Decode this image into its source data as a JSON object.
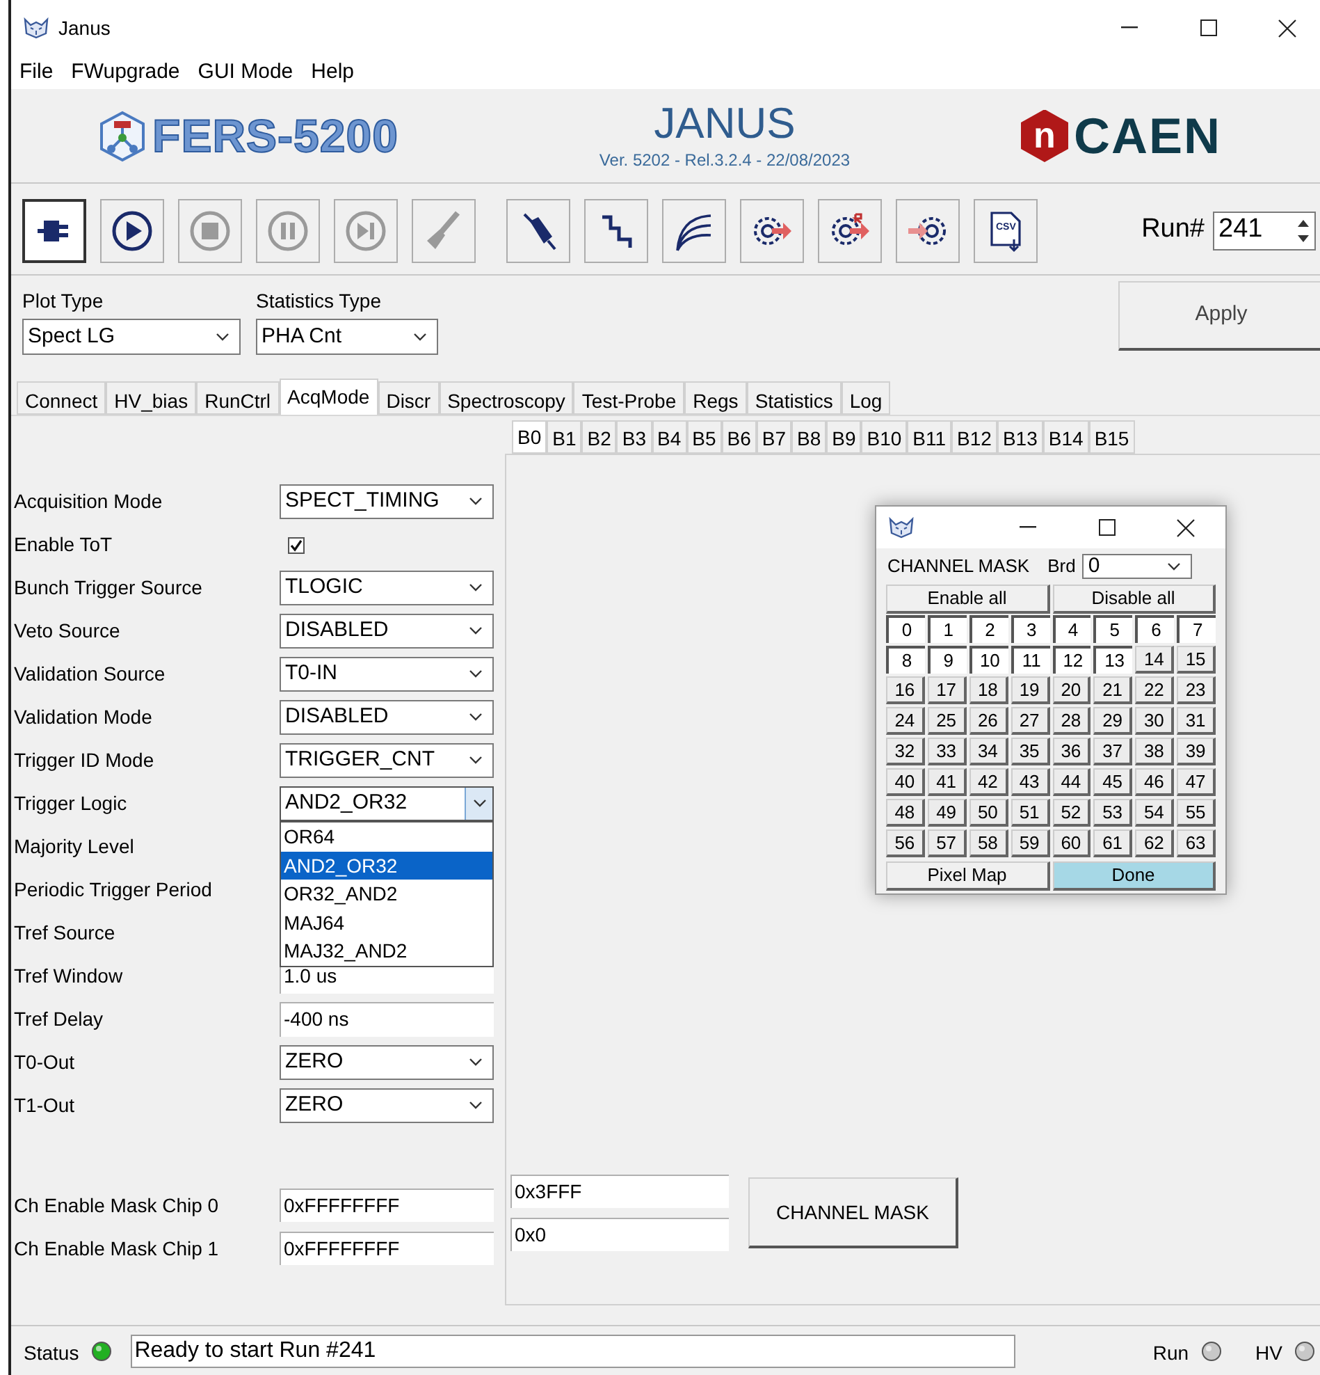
{
  "window": {
    "title": "Janus"
  },
  "menu": [
    "File",
    "FWupgrade",
    "GUI Mode",
    "Help"
  ],
  "header": {
    "product": "FERS-5200",
    "title": "JANUS",
    "version": "Ver. 5202 - Rel.3.2.4 - 22/08/2023",
    "brand_mark": "n",
    "brand": "CAEN"
  },
  "toolbar": [
    {
      "kind": "plug",
      "selected": true,
      "disabled": false
    },
    {
      "kind": "play",
      "selected": false,
      "disabled": false
    },
    {
      "kind": "stop",
      "selected": false,
      "disabled": true
    },
    {
      "kind": "pause",
      "selected": false,
      "disabled": true
    },
    {
      "kind": "step",
      "selected": false,
      "disabled": true
    },
    {
      "kind": "brush",
      "selected": false,
      "disabled": true
    },
    {
      "kind": "probe",
      "selected": false,
      "disabled": false
    },
    {
      "kind": "staircase",
      "selected": false,
      "disabled": false
    },
    {
      "kind": "curves",
      "selected": false,
      "disabled": false
    },
    {
      "kind": "gear-out",
      "selected": false,
      "disabled": false
    },
    {
      "kind": "gear-out-r",
      "selected": false,
      "disabled": false
    },
    {
      "kind": "gear-in",
      "selected": false,
      "disabled": false
    },
    {
      "kind": "csv",
      "label": "CSV",
      "selected": false,
      "disabled": false
    }
  ],
  "run": {
    "label": "Run#",
    "value": "241"
  },
  "plot_type": {
    "label": "Plot Type",
    "value": "Spect LG"
  },
  "statistics_type": {
    "label": "Statistics Type",
    "value": "PHA Cnt"
  },
  "apply_button": "Apply",
  "tabs": [
    {
      "label": "Connect",
      "selected": false
    },
    {
      "label": "HV_bias",
      "selected": false
    },
    {
      "label": "RunCtrl",
      "selected": false
    },
    {
      "label": "AcqMode",
      "selected": true
    },
    {
      "label": "Discr",
      "selected": false
    },
    {
      "label": "Spectroscopy",
      "selected": false
    },
    {
      "label": "Test-Probe",
      "selected": false
    },
    {
      "label": "Regs",
      "selected": false
    },
    {
      "label": "Statistics",
      "selected": false
    },
    {
      "label": "Log",
      "selected": false
    }
  ],
  "board_tabs": [
    {
      "label": "B0",
      "selected": true
    },
    {
      "label": "B1",
      "selected": false
    },
    {
      "label": "B2",
      "selected": false
    },
    {
      "label": "B3",
      "selected": false
    },
    {
      "label": "B4",
      "selected": false
    },
    {
      "label": "B5",
      "selected": false
    },
    {
      "label": "B6",
      "selected": false
    },
    {
      "label": "B7",
      "selected": false
    },
    {
      "label": "B8",
      "selected": false
    },
    {
      "label": "B9",
      "selected": false
    },
    {
      "label": "B10",
      "selected": false
    },
    {
      "label": "B11",
      "selected": false
    },
    {
      "label": "B12",
      "selected": false
    },
    {
      "label": "B13",
      "selected": false
    },
    {
      "label": "B14",
      "selected": false
    },
    {
      "label": "B15",
      "selected": false
    }
  ],
  "settings": [
    {
      "label": "Acquisition Mode",
      "kind": "dropdown",
      "value": "SPECT_TIMING"
    },
    {
      "label": "Enable ToT",
      "kind": "checkbox",
      "checked": true
    },
    {
      "label": "Bunch Trigger Source",
      "kind": "dropdown",
      "value": "TLOGIC"
    },
    {
      "label": "Veto Source",
      "kind": "dropdown",
      "value": "DISABLED"
    },
    {
      "label": "Validation Source",
      "kind": "dropdown",
      "value": "T0-IN"
    },
    {
      "label": "Validation Mode",
      "kind": "dropdown",
      "value": "DISABLED"
    },
    {
      "label": "Trigger ID Mode",
      "kind": "dropdown",
      "value": "TRIGGER_CNT"
    },
    {
      "label": "Trigger Logic",
      "kind": "dropdown",
      "value": "AND2_OR32",
      "expanded": true,
      "options": [
        {
          "label": "OR64",
          "selected": false
        },
        {
          "label": "AND2_OR32",
          "selected": true
        },
        {
          "label": "OR32_AND2",
          "selected": false
        },
        {
          "label": "MAJ64",
          "selected": false
        },
        {
          "label": "MAJ32_AND2",
          "selected": false
        }
      ]
    },
    {
      "label": "Majority Level",
      "kind": "covered"
    },
    {
      "label": "Periodic Trigger Period",
      "kind": "covered"
    },
    {
      "label": "Tref Source",
      "kind": "covered"
    },
    {
      "label": "Tref Window",
      "kind": "text",
      "value": "1.0 us"
    },
    {
      "label": "Tref Delay",
      "kind": "text",
      "value": "-400 ns"
    },
    {
      "label": "T0-Out",
      "kind": "dropdown",
      "value": "ZERO"
    },
    {
      "label": "T1-Out",
      "kind": "dropdown",
      "value": "ZERO"
    }
  ],
  "channel_masks": [
    {
      "label": "Ch Enable Mask Chip 0",
      "values": [
        "0xFFFFFFFF",
        "0x3FFF"
      ]
    },
    {
      "label": "Ch Enable Mask Chip 1",
      "values": [
        "0xFFFFFFFF",
        "0x0"
      ]
    }
  ],
  "channel_mask_button": "CHANNEL MASK",
  "channel_mask_dialog": {
    "title": "CHANNEL MASK",
    "board_label": "Brd",
    "board_value": "0",
    "top_buttons": [
      "Enable all",
      "Disable all"
    ],
    "channels": [
      {
        "label": "0",
        "enabled": true
      },
      {
        "label": "1",
        "enabled": true
      },
      {
        "label": "2",
        "enabled": true
      },
      {
        "label": "3",
        "enabled": true
      },
      {
        "label": "4",
        "enabled": true
      },
      {
        "label": "5",
        "enabled": true
      },
      {
        "label": "6",
        "enabled": true
      },
      {
        "label": "7",
        "enabled": true
      },
      {
        "label": "8",
        "enabled": true
      },
      {
        "label": "9",
        "enabled": true
      },
      {
        "label": "10",
        "enabled": true
      },
      {
        "label": "11",
        "enabled": true
      },
      {
        "label": "12",
        "enabled": true
      },
      {
        "label": "13",
        "enabled": true
      },
      {
        "label": "14",
        "enabled": false
      },
      {
        "label": "15",
        "enabled": false
      },
      {
        "label": "16",
        "enabled": false
      },
      {
        "label": "17",
        "enabled": false
      },
      {
        "label": "18",
        "enabled": false
      },
      {
        "label": "19",
        "enabled": false
      },
      {
        "label": "20",
        "enabled": false
      },
      {
        "label": "21",
        "enabled": false
      },
      {
        "label": "22",
        "enabled": false
      },
      {
        "label": "23",
        "enabled": false
      },
      {
        "label": "24",
        "enabled": false
      },
      {
        "label": "25",
        "enabled": false
      },
      {
        "label": "26",
        "enabled": false
      },
      {
        "label": "27",
        "enabled": false
      },
      {
        "label": "28",
        "enabled": false
      },
      {
        "label": "29",
        "enabled": false
      },
      {
        "label": "30",
        "enabled": false
      },
      {
        "label": "31",
        "enabled": false
      },
      {
        "label": "32",
        "enabled": false
      },
      {
        "label": "33",
        "enabled": false
      },
      {
        "label": "34",
        "enabled": false
      },
      {
        "label": "35",
        "enabled": false
      },
      {
        "label": "36",
        "enabled": false
      },
      {
        "label": "37",
        "enabled": false
      },
      {
        "label": "38",
        "enabled": false
      },
      {
        "label": "39",
        "enabled": false
      },
      {
        "label": "40",
        "enabled": false
      },
      {
        "label": "41",
        "enabled": false
      },
      {
        "label": "42",
        "enabled": false
      },
      {
        "label": "43",
        "enabled": false
      },
      {
        "label": "44",
        "enabled": false
      },
      {
        "label": "45",
        "enabled": false
      },
      {
        "label": "46",
        "enabled": false
      },
      {
        "label": "47",
        "enabled": false
      },
      {
        "label": "48",
        "enabled": false
      },
      {
        "label": "49",
        "enabled": false
      },
      {
        "label": "50",
        "enabled": false
      },
      {
        "label": "51",
        "enabled": false
      },
      {
        "label": "52",
        "enabled": false
      },
      {
        "label": "53",
        "enabled": false
      },
      {
        "label": "54",
        "enabled": false
      },
      {
        "label": "55",
        "enabled": false
      },
      {
        "label": "56",
        "enabled": false
      },
      {
        "label": "57",
        "enabled": false
      },
      {
        "label": "58",
        "enabled": false
      },
      {
        "label": "59",
        "enabled": false
      },
      {
        "label": "60",
        "enabled": false
      },
      {
        "label": "61",
        "enabled": false
      },
      {
        "label": "62",
        "enabled": false
      },
      {
        "label": "63",
        "enabled": false
      }
    ],
    "bottom_buttons": [
      {
        "label": "Pixel Map",
        "highlighted": false
      },
      {
        "label": "Done",
        "highlighted": true
      }
    ]
  },
  "status_bar": {
    "label": "Status",
    "on": true,
    "message": "Ready to start Run #241",
    "indicators": [
      {
        "label": "Run",
        "on": false
      },
      {
        "label": "HV",
        "on": false
      }
    ]
  }
}
